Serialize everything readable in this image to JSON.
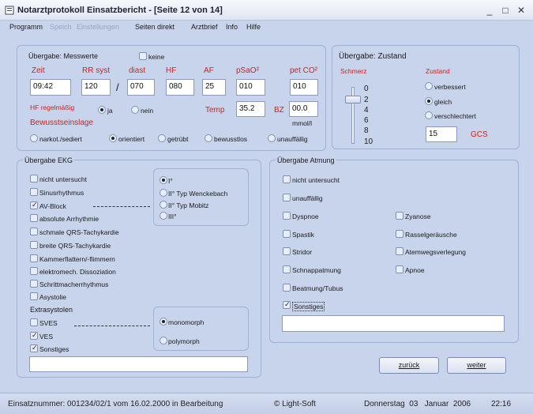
{
  "window": {
    "title": "Notarztprotokoll Einsatzbericht - [Seite 12 von 14]",
    "minimize": "_",
    "maximize": "□",
    "close": "✕"
  },
  "menu": {
    "items": [
      "Programm",
      "Speich",
      "Einstellungen",
      "Seiten direkt",
      "Arztbrief",
      "Info",
      "Hilfe"
    ]
  },
  "messwerte": {
    "title": "Übergabe: Messwerte",
    "keine_label": "keine",
    "labels": [
      "Zeit",
      "RR syst",
      "diast",
      "HF",
      "AF",
      "pSaO²",
      "pet CO²"
    ],
    "values": [
      "09:42",
      "120",
      "070",
      "080",
      "25",
      "010",
      "010"
    ],
    "slash": "/",
    "hf_label": "HF regelmäßig",
    "ja": "ja",
    "nein": "nein",
    "temp_label": "Temp",
    "temp_value": "35.2",
    "bz_label": "BZ",
    "bz_value": "00.0",
    "bz_unit": "mmol/l",
    "bewusst_label": "Bewusstseinslage",
    "bewusst_options": [
      "narkot./sediert",
      "orientiert",
      "getrübt",
      "bewusstlos",
      "unauffällig"
    ]
  },
  "zustand": {
    "title": "Übergabe: Zustand",
    "schmerz_label": "Schmerz",
    "scale": [
      "0",
      "2",
      "4",
      "6",
      "8",
      "10"
    ],
    "zustand_label": "Zustand",
    "zustand_options": [
      "verbessert",
      "gleich",
      "verschlechtert"
    ],
    "gcs_value": "15",
    "gcs_label": "GCS"
  },
  "ekg": {
    "title": "Übergabe EKG",
    "items": [
      "nicht untersucht",
      "Sinusrhythmus",
      "AV-Block",
      "absolute Arrhythmie",
      "schmale QRS-Tachykardie",
      "breite QRS-Tachykardie",
      "Kammerflattern/-flimmern",
      "elektromech. Dissoziation",
      "Schrittmacherrhythmus",
      "Asystolie"
    ],
    "extra_label": "Extrasystolen",
    "extra_items": [
      "SVES",
      "VES",
      "Sonstiges"
    ],
    "av_options": [
      "I°",
      "II° Typ Wenckebach",
      "II° Typ Mobitz",
      "III°"
    ],
    "morph_options": [
      "monomorph",
      "polymorph"
    ]
  },
  "atmung": {
    "title": "Übergabe Atmung",
    "items_left": [
      "nicht untersucht",
      "unauffällig",
      "Dyspnoe",
      "Spastik",
      "Stridor",
      "Schnappatmung",
      "Beatmung/Tubus",
      "Sonstiges"
    ],
    "items_right": [
      "Zyanose",
      "Rasselgeräusche",
      "Atemwegsverlegung",
      "Apnoe"
    ]
  },
  "buttons": {
    "back": "zurück",
    "next": "weiter"
  },
  "status": {
    "einsatz": "Einsatznummer: 001234/02/1 vom 16.02.2000 in Bearbeitung",
    "copyright": "© Light-Soft",
    "date": "Donnerstag  03   Januar  2006",
    "time": "22:16"
  },
  "colors": {
    "accent_red": "#d02020",
    "background": "#c8d4ec"
  }
}
